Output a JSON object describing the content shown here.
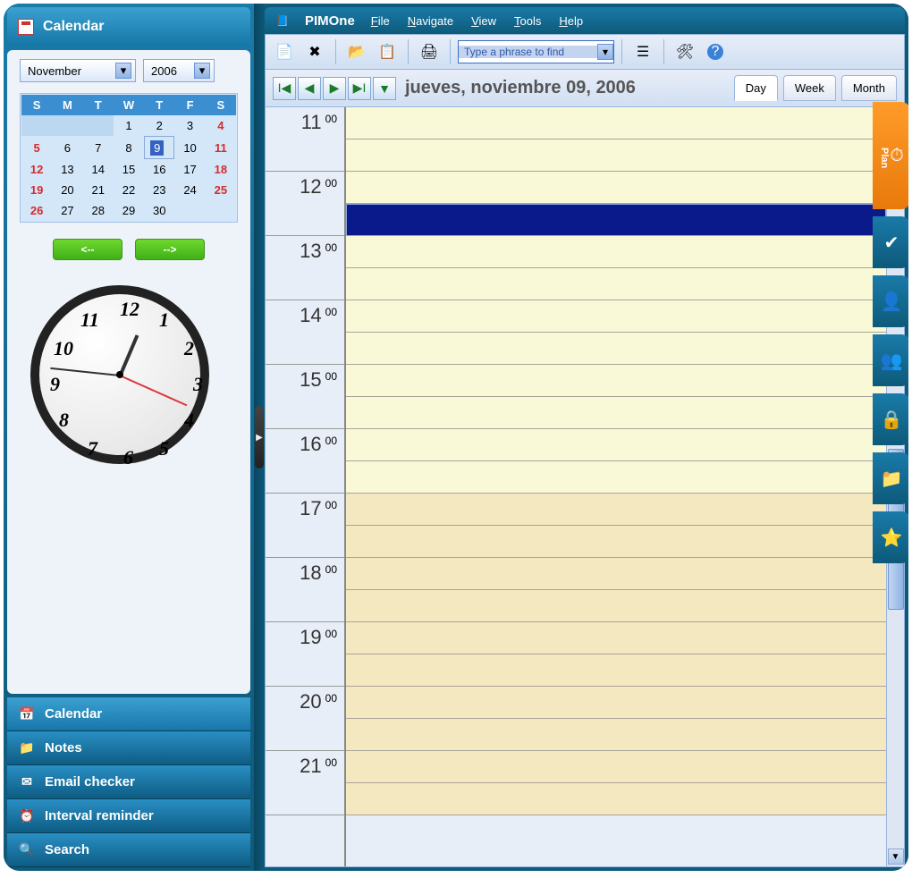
{
  "app": {
    "title": "PIMOne"
  },
  "menu": [
    "File",
    "Navigate",
    "View",
    "Tools",
    "Help"
  ],
  "sidebar": {
    "header": "Calendar",
    "month": "November",
    "year": "2006",
    "weekdays": [
      "S",
      "M",
      "T",
      "W",
      "T",
      "F",
      "S"
    ],
    "nav_prev": "<--",
    "nav_next": "-->",
    "clock_time": {
      "h": 12,
      "m": 46,
      "s": 19
    },
    "nav_items": [
      {
        "icon": "calendar-icon",
        "label": "Calendar"
      },
      {
        "icon": "notes-icon",
        "label": "Notes"
      },
      {
        "icon": "email-icon",
        "label": "Email checker"
      },
      {
        "icon": "reminder-icon",
        "label": "Interval reminder"
      },
      {
        "icon": "search-icon",
        "label": "Search"
      }
    ],
    "cal_rows": [
      [
        "",
        "",
        "",
        "1",
        "2",
        "3",
        "4"
      ],
      [
        "5",
        "6",
        "7",
        "8",
        "9",
        "10",
        "11"
      ],
      [
        "12",
        "13",
        "14",
        "15",
        "16",
        "17",
        "18"
      ],
      [
        "19",
        "20",
        "21",
        "22",
        "23",
        "24",
        "25"
      ],
      [
        "26",
        "27",
        "28",
        "29",
        "30",
        "",
        ""
      ]
    ],
    "selected_day": "9"
  },
  "toolbar": {
    "search_placeholder": "Type a phrase to find"
  },
  "dateline": {
    "text": "jueves, noviembre 09, 2006",
    "tabs": [
      "Day",
      "Week",
      "Month"
    ],
    "active_tab": "Day"
  },
  "dayview": {
    "hours": [
      11,
      12,
      13,
      14,
      15,
      16,
      17,
      18,
      19,
      20,
      21
    ],
    "minute_label": "00",
    "selected_slot": {
      "hour": 12,
      "half": 1
    },
    "pm_start": 17
  },
  "side_tabs": [
    {
      "name": "plan",
      "label": "Plan",
      "icon": "clock-icon"
    },
    {
      "name": "tasks",
      "label": "",
      "icon": "check-icon"
    },
    {
      "name": "contacts",
      "label": "",
      "icon": "person-icon"
    },
    {
      "name": "people",
      "label": "",
      "icon": "people-icon"
    },
    {
      "name": "secure",
      "label": "",
      "icon": "lock-icon"
    },
    {
      "name": "folder",
      "label": "",
      "icon": "folder-icon"
    },
    {
      "name": "favorites",
      "label": "",
      "icon": "star-icon"
    }
  ]
}
